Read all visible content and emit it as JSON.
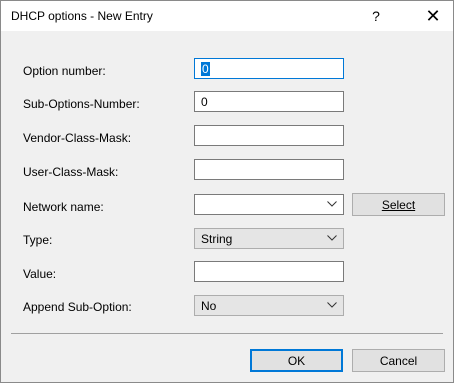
{
  "window": {
    "title": "DHCP options - New Entry",
    "help_symbol": "?",
    "close_symbol": "✕"
  },
  "form": {
    "option_number": {
      "label": "Option number:",
      "value": "0"
    },
    "sub_options_number": {
      "label": "Sub-Options-Number:",
      "value": "0"
    },
    "vendor_class_mask": {
      "label": "Vendor-Class-Mask:",
      "value": ""
    },
    "user_class_mask": {
      "label": "User-Class-Mask:",
      "value": ""
    },
    "network_name": {
      "label": "Network name:",
      "value": "",
      "select_button": "Select"
    },
    "type": {
      "label": "Type:",
      "value": "String"
    },
    "value": {
      "label": "Value:",
      "value": ""
    },
    "append_sub_option": {
      "label": "Append Sub-Option:",
      "value": "No"
    }
  },
  "buttons": {
    "ok": "OK",
    "cancel": "Cancel"
  },
  "icons": {
    "help": "help-icon",
    "close": "close-icon",
    "dropdown": "chevron-down-icon"
  },
  "colors": {
    "accent": "#0078d7",
    "dialog_bg": "#f0f0f0",
    "titlebar_bg": "#ffffff"
  }
}
